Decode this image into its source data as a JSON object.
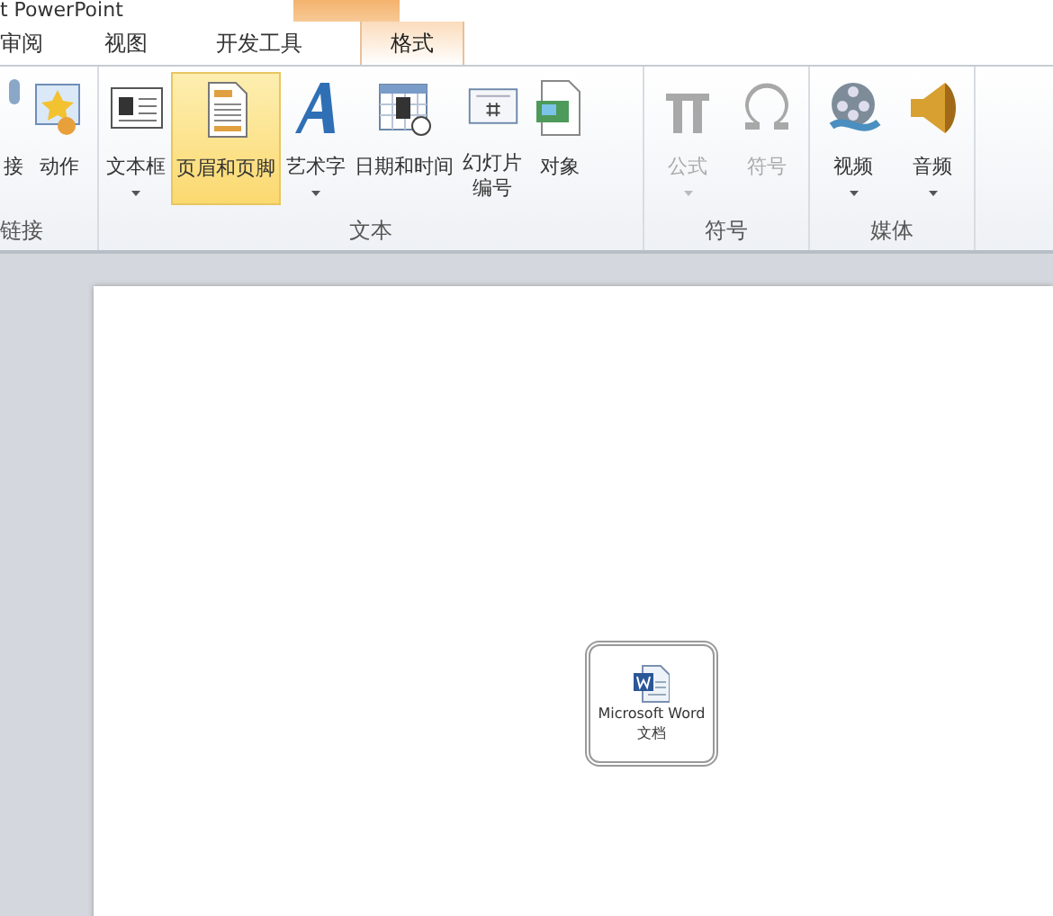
{
  "window": {
    "title": "t PowerPoint",
    "contextual_header": true
  },
  "tabs": [
    {
      "label": "审阅",
      "selected": false,
      "contextual": false
    },
    {
      "label": "视图",
      "selected": false,
      "contextual": false
    },
    {
      "label": "开发工具",
      "selected": false,
      "contextual": false
    },
    {
      "label": "格式",
      "selected": true,
      "contextual": true
    }
  ],
  "ribbon_groups": [
    {
      "label": "链接",
      "buttons": [
        {
          "label": "接",
          "selected": false,
          "disabled": false,
          "dropdown": false
        },
        {
          "label": "动作",
          "selected": false,
          "disabled": false,
          "dropdown": false
        }
      ]
    },
    {
      "label": "文本",
      "buttons": [
        {
          "label": "文本框",
          "selected": false,
          "disabled": false,
          "dropdown": true
        },
        {
          "label": "页眉和页脚",
          "selected": true,
          "disabled": false,
          "dropdown": false
        },
        {
          "label": "艺术字",
          "selected": false,
          "disabled": false,
          "dropdown": true
        },
        {
          "label": "日期和时间",
          "selected": false,
          "disabled": false,
          "dropdown": false
        },
        {
          "label": "幻灯片编号",
          "selected": false,
          "disabled": false,
          "dropdown": false,
          "wrap": true
        },
        {
          "label": "对象",
          "selected": false,
          "disabled": false,
          "dropdown": false
        }
      ]
    },
    {
      "label": "符号",
      "buttons": [
        {
          "label": "公式",
          "selected": false,
          "disabled": true,
          "dropdown": true
        },
        {
          "label": "符号",
          "selected": false,
          "disabled": true,
          "dropdown": false
        }
      ]
    },
    {
      "label": "媒体",
      "buttons": [
        {
          "label": "视频",
          "selected": false,
          "disabled": false,
          "dropdown": true
        },
        {
          "label": "音频",
          "selected": false,
          "disabled": false,
          "dropdown": true
        }
      ]
    }
  ],
  "slide": {
    "embedded_object": {
      "label": "Microsoft Word\n文档",
      "selected": true
    }
  }
}
